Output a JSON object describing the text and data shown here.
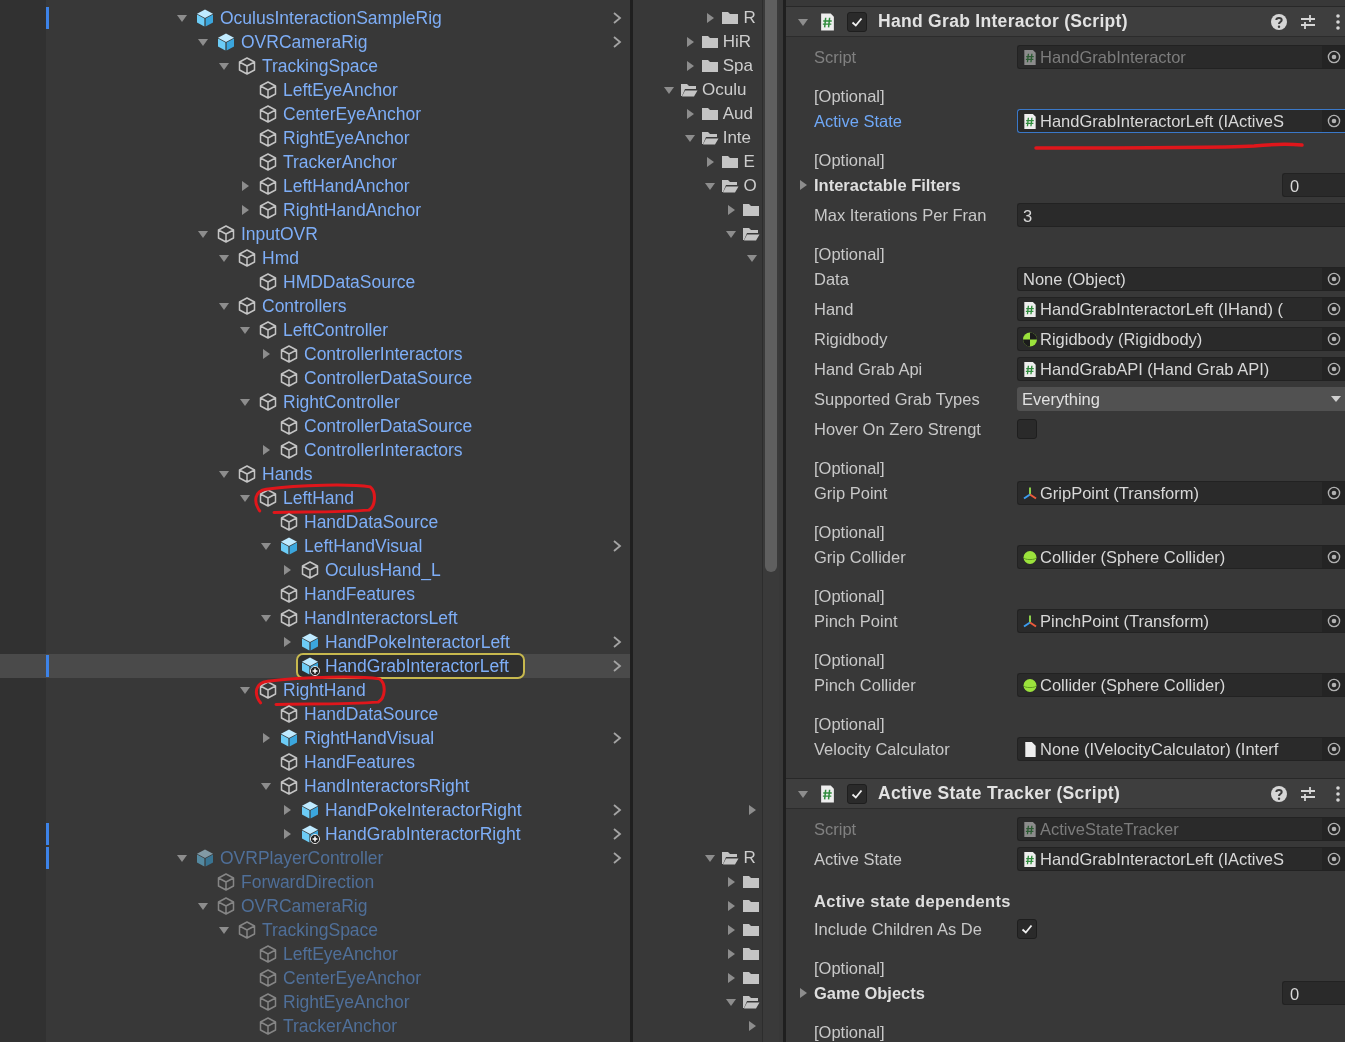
{
  "hierarchy": {
    "items": [
      {
        "name": "OculusInteractionSampleRig",
        "kind": "prefab",
        "expanded": true,
        "active": true,
        "selected": false,
        "circled": false,
        "marked": true,
        "children": [
          {
            "name": "OVRCameraRig",
            "kind": "prefab",
            "expanded": true,
            "selected": false,
            "circled": false,
            "marked": false,
            "children": [
              {
                "name": "TrackingSpace",
                "kind": "object",
                "expanded": true,
                "selected": false,
                "circled": false,
                "marked": false,
                "children": [
                  {
                    "name": "LeftEyeAnchor",
                    "kind": "object",
                    "selected": false,
                    "circled": false,
                    "marked": false
                  },
                  {
                    "name": "CenterEyeAnchor",
                    "kind": "object",
                    "selected": false,
                    "circled": false,
                    "marked": false
                  },
                  {
                    "name": "RightEyeAnchor",
                    "kind": "object",
                    "selected": false,
                    "circled": false,
                    "marked": false
                  },
                  {
                    "name": "TrackerAnchor",
                    "kind": "object",
                    "selected": false,
                    "circled": false,
                    "marked": false
                  },
                  {
                    "name": "LeftHandAnchor",
                    "kind": "object",
                    "expanded": false,
                    "selected": false,
                    "circled": false,
                    "marked": false
                  },
                  {
                    "name": "RightHandAnchor",
                    "kind": "object",
                    "expanded": false,
                    "selected": false,
                    "circled": false,
                    "marked": false
                  }
                ]
              }
            ]
          },
          {
            "name": "InputOVR",
            "kind": "object",
            "expanded": true,
            "selected": false,
            "circled": false,
            "marked": false,
            "children": [
              {
                "name": "Hmd",
                "kind": "object",
                "expanded": true,
                "selected": false,
                "circled": false,
                "marked": false,
                "children": [
                  {
                    "name": "HMDDataSource",
                    "kind": "object",
                    "selected": false,
                    "circled": false,
                    "marked": false
                  }
                ]
              },
              {
                "name": "Controllers",
                "kind": "object",
                "expanded": true,
                "selected": false,
                "circled": false,
                "marked": false,
                "children": [
                  {
                    "name": "LeftController",
                    "kind": "object",
                    "expanded": true,
                    "selected": false,
                    "circled": false,
                    "marked": false,
                    "children": [
                      {
                        "name": "ControllerInteractors",
                        "kind": "object",
                        "expanded": false,
                        "selected": false,
                        "circled": false,
                        "marked": false
                      },
                      {
                        "name": "ControllerDataSource",
                        "kind": "object",
                        "selected": false,
                        "circled": false,
                        "marked": false
                      }
                    ]
                  },
                  {
                    "name": "RightController",
                    "kind": "object",
                    "expanded": true,
                    "selected": false,
                    "circled": false,
                    "marked": false,
                    "children": [
                      {
                        "name": "ControllerDataSource",
                        "kind": "object",
                        "selected": false,
                        "circled": false,
                        "marked": false
                      },
                      {
                        "name": "ControllerInteractors",
                        "kind": "object",
                        "expanded": false,
                        "selected": false,
                        "circled": false,
                        "marked": false
                      }
                    ]
                  }
                ]
              },
              {
                "name": "Hands",
                "kind": "object",
                "expanded": true,
                "selected": false,
                "circled": false,
                "marked": false,
                "children": [
                  {
                    "name": "LeftHand",
                    "kind": "object",
                    "expanded": true,
                    "selected": false,
                    "circled": true,
                    "marked": false,
                    "children": [
                      {
                        "name": "HandDataSource",
                        "kind": "object",
                        "selected": false,
                        "circled": false,
                        "marked": false
                      },
                      {
                        "name": "LeftHandVisual",
                        "kind": "prefab",
                        "expanded": true,
                        "selected": false,
                        "circled": false,
                        "marked": false,
                        "children": [
                          {
                            "name": "OculusHand_L",
                            "kind": "object",
                            "expanded": false,
                            "selected": false,
                            "circled": false,
                            "marked": false
                          }
                        ]
                      },
                      {
                        "name": "HandFeatures",
                        "kind": "object",
                        "selected": false,
                        "circled": false,
                        "marked": false
                      },
                      {
                        "name": "HandInteractorsLeft",
                        "kind": "object",
                        "expanded": true,
                        "selected": false,
                        "circled": false,
                        "marked": false,
                        "children": [
                          {
                            "name": "HandPokeInteractorLeft",
                            "kind": "prefab",
                            "expanded": false,
                            "selected": false,
                            "circled": false,
                            "marked": false
                          },
                          {
                            "name": "HandGrabInteractorLeft",
                            "kind": "prefab-add",
                            "selected": true,
                            "circled": false,
                            "marked": true
                          }
                        ]
                      }
                    ]
                  },
                  {
                    "name": "RightHand",
                    "kind": "object",
                    "expanded": true,
                    "selected": false,
                    "circled": true,
                    "marked": false,
                    "children": [
                      {
                        "name": "HandDataSource",
                        "kind": "object",
                        "selected": false,
                        "circled": false,
                        "marked": false
                      },
                      {
                        "name": "RightHandVisual",
                        "kind": "prefab",
                        "expanded": false,
                        "selected": false,
                        "circled": false,
                        "marked": false
                      },
                      {
                        "name": "HandFeatures",
                        "kind": "object",
                        "selected": false,
                        "circled": false,
                        "marked": false
                      },
                      {
                        "name": "HandInteractorsRight",
                        "kind": "object",
                        "expanded": true,
                        "selected": false,
                        "circled": false,
                        "marked": false,
                        "children": [
                          {
                            "name": "HandPokeInteractorRight",
                            "kind": "prefab",
                            "expanded": false,
                            "selected": false,
                            "circled": false,
                            "marked": false
                          },
                          {
                            "name": "HandGrabInteractorRight",
                            "kind": "prefab-add",
                            "expanded": false,
                            "selected": false,
                            "circled": false,
                            "marked": true
                          }
                        ]
                      }
                    ]
                  }
                ]
              }
            ]
          }
        ]
      },
      {
        "name": "OVRPlayerController",
        "kind": "prefab",
        "expanded": true,
        "active": false,
        "selected": false,
        "circled": false,
        "marked": true,
        "children": [
          {
            "name": "ForwardDirection",
            "kind": "object",
            "selected": false,
            "circled": false,
            "marked": false
          },
          {
            "name": "OVRCameraRig",
            "kind": "object",
            "expanded": true,
            "selected": false,
            "circled": false,
            "marked": false,
            "children": [
              {
                "name": "TrackingSpace",
                "kind": "object",
                "expanded": true,
                "selected": false,
                "circled": false,
                "marked": false,
                "children": [
                  {
                    "name": "LeftEyeAnchor",
                    "kind": "object",
                    "selected": false,
                    "circled": false,
                    "marked": false
                  },
                  {
                    "name": "CenterEyeAnchor",
                    "kind": "object",
                    "selected": false,
                    "circled": false,
                    "marked": false
                  },
                  {
                    "name": "RightEyeAnchor",
                    "kind": "object",
                    "selected": false,
                    "circled": false,
                    "marked": false
                  },
                  {
                    "name": "TrackerAnchor",
                    "kind": "object",
                    "selected": false,
                    "circled": false,
                    "marked": false
                  }
                ]
              }
            ]
          }
        ]
      }
    ]
  },
  "project": {
    "groups": [
      {
        "items": [
          {
            "kind": "folder",
            "name": "R",
            "expanded": false
          }
        ]
      },
      {
        "items": [
          {
            "kind": "folder",
            "name": "HiR",
            "expanded": false
          },
          {
            "kind": "folder",
            "name": "Spa",
            "expanded": false
          }
        ]
      },
      {
        "items": [
          {
            "kind": "folder",
            "name": "Oculu",
            "expanded": true,
            "children": [
              {
                "kind": "folder",
                "name": "Aud",
                "expanded": false
              },
              {
                "kind": "folder",
                "name": "Inte",
                "expanded": true,
                "children": [
                  {
                    "kind": "folder",
                    "name": "E",
                    "expanded": false
                  },
                  {
                    "kind": "folder",
                    "name": "O",
                    "expanded": true,
                    "children": [
                      {
                        "kind": "folder",
                        "expanded": false
                      },
                      {
                        "kind": "folder",
                        "expanded": true,
                        "children": [
                          {
                            "expanded": true
                          }
                        ]
                      }
                    ]
                  }
                ]
              }
            ]
          }
        ]
      },
      {
        "items": [
          {
            "expanded": false
          }
        ]
      },
      {
        "items": [
          {
            "kind": "folder",
            "name": "R",
            "expanded": true,
            "children": [
              {
                "kind": "folder",
                "expanded": false
              },
              {
                "kind": "folder",
                "expanded": false
              },
              {
                "kind": "folder",
                "expanded": false
              },
              {
                "kind": "folder",
                "expanded": false
              },
              {
                "kind": "folder",
                "expanded": false
              },
              {
                "kind": "folder",
                "expanded": true,
                "children": [
                  {
                    "expanded": false
                  }
                ]
              }
            ]
          }
        ]
      }
    ]
  },
  "inspector": {
    "components": [
      {
        "title": "Hand Grab Interactor (Script)",
        "enabled": true,
        "expanded": true,
        "properties": [
          {
            "kind": "script-object",
            "label": "Script",
            "value": "HandGrabInteractor",
            "disabled": true,
            "focused": false,
            "underlined": false
          },
          {
            "kind": "script-object",
            "note": "[Optional]",
            "label": "Active State",
            "value": "HandGrabInteractorLeft (IActiveS",
            "disabled": false,
            "focused": true,
            "underlined": true
          },
          {
            "kind": "array",
            "note": "[Optional]",
            "label": "Interactable Filters",
            "size": "0",
            "expanded": false
          },
          {
            "kind": "number",
            "label": "Max Iterations Per Fran",
            "value": "3"
          },
          {
            "kind": "object",
            "note": "[Optional]",
            "label": "Data",
            "value": "None (Object)",
            "disabled": false,
            "focused": false,
            "underlined": false
          },
          {
            "kind": "script-object",
            "label": "Hand",
            "value": "HandGrabInteractorLeft (IHand) (",
            "disabled": false,
            "focused": false,
            "underlined": false
          },
          {
            "kind": "rigidbody-object",
            "label": "Rigidbody",
            "value": "Rigidbody (Rigidbody)",
            "disabled": false,
            "focused": false,
            "underlined": false
          },
          {
            "kind": "script-object",
            "label": "Hand Grab Api",
            "value": "HandGrabAPI (Hand Grab API)",
            "disabled": false,
            "focused": false,
            "underlined": false
          },
          {
            "kind": "dropdown",
            "label": "Supported Grab Types",
            "value": "Everything"
          },
          {
            "kind": "checkbox",
            "label": "Hover On Zero Strengt",
            "checked": false
          },
          {
            "kind": "transform-object",
            "note": "[Optional]",
            "label": "Grip Point",
            "value": "GripPoint (Transform)",
            "disabled": false,
            "focused": false,
            "underlined": false
          },
          {
            "kind": "collider-object",
            "note": "[Optional]",
            "label": "Grip Collider",
            "value": "Collider (Sphere Collider)",
            "disabled": false,
            "focused": false,
            "underlined": false
          },
          {
            "kind": "transform-object",
            "note": "[Optional]",
            "label": "Pinch Point",
            "value": "PinchPoint (Transform)",
            "disabled": false,
            "focused": false,
            "underlined": false
          },
          {
            "kind": "collider-object",
            "note": "[Optional]",
            "label": "Pinch Collider",
            "value": "Collider (Sphere Collider)",
            "disabled": false,
            "focused": false,
            "underlined": false
          },
          {
            "kind": "document-object",
            "note": "[Optional]",
            "label": "Velocity Calculator",
            "value": "None (IVelocityCalculator) (Interf",
            "disabled": false,
            "focused": false,
            "underlined": false
          }
        ]
      },
      {
        "title": "Active State Tracker (Script)",
        "enabled": true,
        "expanded": true,
        "properties": [
          {
            "kind": "script-object",
            "label": "Script",
            "value": "ActiveStateTracker",
            "disabled": true,
            "focused": false,
            "underlined": false
          },
          {
            "kind": "script-object",
            "label": "Active State",
            "value": "HandGrabInteractorLeft (IActiveS",
            "disabled": false,
            "focused": false,
            "underlined": false
          },
          {
            "kind": "heading",
            "label": "Active state dependents"
          },
          {
            "kind": "checkbox",
            "label": "Include Children As De",
            "checked": true
          },
          {
            "kind": "array",
            "note": "[Optional]",
            "label": "Game Objects",
            "size": "0",
            "expanded": false
          },
          {
            "kind": "note",
            "note": "[Optional]"
          }
        ]
      }
    ]
  }
}
